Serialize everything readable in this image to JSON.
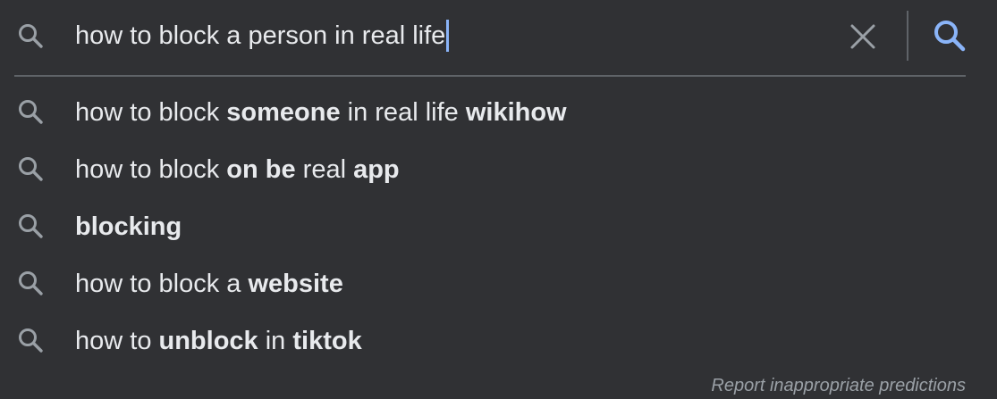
{
  "search": {
    "query": "how to block a person in real life",
    "left_icon": "search-icon",
    "clear_icon": "close-icon",
    "submit_icon": "search-icon"
  },
  "suggestions": [
    {
      "parts": [
        {
          "text": "how to block ",
          "bold": false
        },
        {
          "text": "someone",
          "bold": true
        },
        {
          "text": " in real life ",
          "bold": false
        },
        {
          "text": "wikihow",
          "bold": true
        }
      ]
    },
    {
      "parts": [
        {
          "text": "how to block ",
          "bold": false
        },
        {
          "text": "on be",
          "bold": true
        },
        {
          "text": " real ",
          "bold": false
        },
        {
          "text": "app",
          "bold": true
        }
      ]
    },
    {
      "parts": [
        {
          "text": "blocking",
          "bold": true
        }
      ]
    },
    {
      "parts": [
        {
          "text": "how to block a ",
          "bold": false
        },
        {
          "text": "website",
          "bold": true
        }
      ]
    },
    {
      "parts": [
        {
          "text": "how to ",
          "bold": false
        },
        {
          "text": "unblock",
          "bold": true
        },
        {
          "text": " in ",
          "bold": false
        },
        {
          "text": "tiktok",
          "bold": true
        }
      ]
    }
  ],
  "report_link": "Report inappropriate predictions",
  "colors": {
    "background": "#303134",
    "text": "#e8eaed",
    "muted": "#9aa0a6",
    "accent": "#8ab4f8",
    "divider": "#5f6368"
  }
}
